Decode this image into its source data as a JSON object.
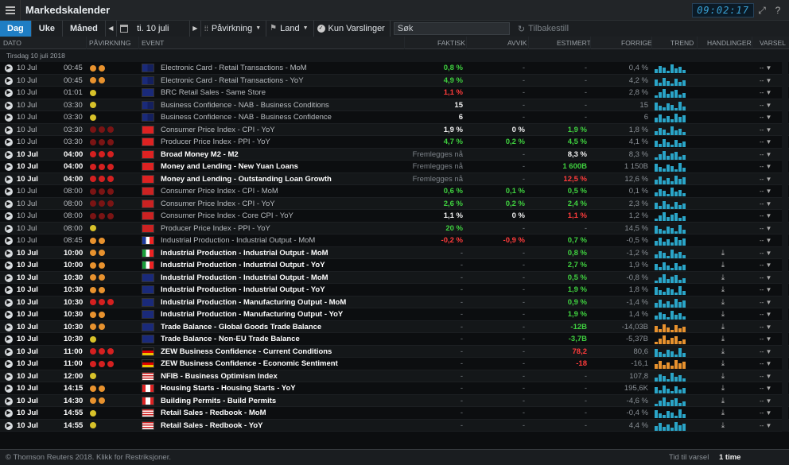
{
  "app": {
    "title": "Markedskalender",
    "clock": "09:02:17"
  },
  "toolbar": {
    "tabs": [
      "Dag",
      "Uke",
      "Måned"
    ],
    "date": "ti. 10 juli",
    "impact_label": "Påvirkning",
    "country_label": "Land",
    "alerts_only_label": "Kun Varslinger",
    "search_placeholder": "Søk",
    "reset_label": "Tilbakestill"
  },
  "columns": {
    "date": "DATO",
    "impact": "PÅVIRKNING",
    "event": "EVENT",
    "actual": "FAKTISK",
    "deviation": "AVVIK",
    "estimate": "ESTIMERT",
    "previous": "FORRIGE",
    "trend": "TREND",
    "actions": "HANDLINGER",
    "alert": "VARSEL"
  },
  "group_label": "Tirsdag 10 juli 2018",
  "colors": {
    "accent": "#1f7ec4",
    "orange": "#e8922e",
    "red": "#d42020",
    "yellow": "#d8c22a",
    "green": "#3fd13f",
    "trend": "#2aa5c8"
  },
  "rows": [
    {
      "date": "10 Jul",
      "time": "00:45",
      "impact": "medium",
      "country": "AU",
      "event": "Electronic Card - Retail Transactions - MoM",
      "actual": "0,8 %",
      "actual_c": "green",
      "dev": "-",
      "est": "-",
      "prev": "0,4 %",
      "action": false
    },
    {
      "date": "10 Jul",
      "time": "00:45",
      "impact": "medium",
      "country": "AU",
      "event": "Electronic Card - Retail Transactions - YoY",
      "actual": "4,9 %",
      "actual_c": "green",
      "dev": "-",
      "est": "-",
      "prev": "4,2 %",
      "action": false
    },
    {
      "date": "10 Jul",
      "time": "01:01",
      "impact": "low",
      "country": "UK",
      "event": "BRC Retail Sales - Same Store",
      "actual": "1,1 %",
      "actual_c": "red",
      "dev": "-",
      "est": "-",
      "prev": "2,8 %",
      "action": false
    },
    {
      "date": "10 Jul",
      "time": "03:30",
      "impact": "low",
      "country": "AU",
      "event": "Business Confidence - NAB - Business Conditions",
      "actual": "15",
      "actual_c": "white",
      "dev": "-",
      "est": "-",
      "prev": "15",
      "action": false
    },
    {
      "date": "10 Jul",
      "time": "03:30",
      "impact": "low",
      "country": "AU",
      "event": "Business Confidence - NAB - Business Confidence",
      "actual": "6",
      "actual_c": "white",
      "dev": "-",
      "est": "-",
      "prev": "6",
      "action": false
    },
    {
      "date": "10 Jul",
      "time": "03:30",
      "impact": "high-dim",
      "country": "CN",
      "event": "Consumer Price Index - CPI - YoY",
      "actual": "1,9 %",
      "actual_c": "white",
      "dev": "0 %",
      "dev_c": "white",
      "est": "1,9 %",
      "est_c": "green",
      "prev": "1,8 %",
      "action": false
    },
    {
      "date": "10 Jul",
      "time": "03:30",
      "impact": "high-dim",
      "country": "CN",
      "event": "Producer Price Index - PPI - YoY",
      "actual": "4,7 %",
      "actual_c": "green",
      "dev": "0,2 %",
      "dev_c": "green",
      "est": "4,5 %",
      "est_c": "green",
      "prev": "4,1 %",
      "action": false
    },
    {
      "date": "10 Jul",
      "time": "04:00",
      "impact": "high",
      "country": "CN",
      "event": "Broad Money M2 - M2",
      "actual": "Fremlegges nå",
      "actual_c": "pending",
      "dev": "-",
      "est": "8,3 %",
      "est_c": "white",
      "prev": "8,3 %",
      "action": false,
      "hi": true
    },
    {
      "date": "10 Jul",
      "time": "04:00",
      "impact": "high",
      "country": "CN",
      "event": "Money and Lending - New Yuan Loans",
      "actual": "Fremlegges nå",
      "actual_c": "pending",
      "dev": "-",
      "est": "1 600B",
      "est_c": "green",
      "prev": "1 150B",
      "action": false,
      "hi": true
    },
    {
      "date": "10 Jul",
      "time": "04:00",
      "impact": "high",
      "country": "CN",
      "event": "Money and Lending - Outstanding Loan Growth",
      "actual": "Fremlegges nå",
      "actual_c": "pending",
      "dev": "-",
      "est": "12,5 %",
      "est_c": "red",
      "prev": "12,6 %",
      "action": false,
      "hi": true
    },
    {
      "date": "10 Jul",
      "time": "08:00",
      "impact": "high-dim",
      "country": "NO",
      "event": "Consumer Price Index - CPI - MoM",
      "actual": "0,6 %",
      "actual_c": "green",
      "dev": "0,1 %",
      "dev_c": "green",
      "est": "0,5 %",
      "est_c": "green",
      "prev": "0,1 %",
      "action": false
    },
    {
      "date": "10 Jul",
      "time": "08:00",
      "impact": "high-dim",
      "country": "NO",
      "event": "Consumer Price Index - CPI - YoY",
      "actual": "2,6 %",
      "actual_c": "green",
      "dev": "0,2 %",
      "dev_c": "green",
      "est": "2,4 %",
      "est_c": "green",
      "prev": "2,3 %",
      "action": false
    },
    {
      "date": "10 Jul",
      "time": "08:00",
      "impact": "high-dim",
      "country": "NO",
      "event": "Consumer Price Index - Core CPI - YoY",
      "actual": "1,1 %",
      "actual_c": "white",
      "dev": "0 %",
      "dev_c": "white",
      "est": "1,1 %",
      "est_c": "red",
      "prev": "1,2 %",
      "action": false
    },
    {
      "date": "10 Jul",
      "time": "08:00",
      "impact": "low",
      "country": "NO",
      "event": "Producer Price Index - PPI - YoY",
      "actual": "20 %",
      "actual_c": "green",
      "dev": "-",
      "est": "-",
      "prev": "14,5 %",
      "action": false
    },
    {
      "date": "10 Jul",
      "time": "08:45",
      "impact": "medium",
      "country": "FR",
      "event": "Industrial Production - Industrial Output - MoM",
      "actual": "-0,2 %",
      "actual_c": "red",
      "dev": "-0,9 %",
      "dev_c": "red",
      "est": "0,7 %",
      "est_c": "green",
      "prev": "-0,5 %",
      "action": false
    },
    {
      "date": "10 Jul",
      "time": "10:00",
      "impact": "medium",
      "country": "IT",
      "event": "Industrial Production - Industrial Output - MoM",
      "actual": "-",
      "dev": "-",
      "est": "0,8 %",
      "est_c": "green",
      "prev": "-1,2 %",
      "action": true,
      "hi": true
    },
    {
      "date": "10 Jul",
      "time": "10:00",
      "impact": "medium",
      "country": "IT",
      "event": "Industrial Production - Industrial Output - YoY",
      "actual": "-",
      "dev": "-",
      "est": "2,7 %",
      "est_c": "green",
      "prev": "1,9 %",
      "action": true,
      "hi": true
    },
    {
      "date": "10 Jul",
      "time": "10:30",
      "impact": "medium",
      "country": "UK",
      "event": "Industrial Production - Industrial Output - MoM",
      "actual": "-",
      "dev": "-",
      "est": "0,5 %",
      "est_c": "green",
      "prev": "-0,8 %",
      "action": true,
      "hi": true
    },
    {
      "date": "10 Jul",
      "time": "10:30",
      "impact": "medium",
      "country": "UK",
      "event": "Industrial Production - Industrial Output - YoY",
      "actual": "-",
      "dev": "-",
      "est": "1,9 %",
      "est_c": "green",
      "prev": "1,8 %",
      "action": true,
      "hi": true
    },
    {
      "date": "10 Jul",
      "time": "10:30",
      "impact": "high",
      "country": "UK",
      "event": "Industrial Production - Manufacturing Output - MoM",
      "actual": "-",
      "dev": "-",
      "est": "0,9 %",
      "est_c": "green",
      "prev": "-1,4 %",
      "action": true,
      "hi": true
    },
    {
      "date": "10 Jul",
      "time": "10:30",
      "impact": "medium",
      "country": "UK",
      "event": "Industrial Production - Manufacturing Output - YoY",
      "actual": "-",
      "dev": "-",
      "est": "1,9 %",
      "est_c": "green",
      "prev": "1,4 %",
      "action": true,
      "hi": true
    },
    {
      "date": "10 Jul",
      "time": "10:30",
      "impact": "medium",
      "country": "UK",
      "event": "Trade Balance - Global Goods Trade Balance",
      "actual": "-",
      "dev": "-",
      "est": "-12B",
      "est_c": "green",
      "prev": "-14,03B",
      "action": true,
      "hi": true,
      "trend_c": "orange"
    },
    {
      "date": "10 Jul",
      "time": "10:30",
      "impact": "low",
      "country": "UK",
      "event": "Trade Balance - Non-EU Trade Balance",
      "actual": "-",
      "dev": "-",
      "est": "-3,7B",
      "est_c": "green",
      "prev": "-5,37B",
      "action": true,
      "hi": true,
      "trend_c": "orange"
    },
    {
      "date": "10 Jul",
      "time": "11:00",
      "impact": "high",
      "country": "DE",
      "event": "ZEW Business Confidence - Current Conditions",
      "actual": "-",
      "dev": "-",
      "est": "78,2",
      "est_c": "red",
      "prev": "80,6",
      "action": true,
      "hi": true
    },
    {
      "date": "10 Jul",
      "time": "11:00",
      "impact": "high",
      "country": "DE",
      "event": "ZEW Business Confidence - Economic Sentiment",
      "actual": "-",
      "dev": "-",
      "est": "-18",
      "est_c": "red",
      "prev": "-16,1",
      "action": true,
      "hi": true,
      "trend_c": "orange"
    },
    {
      "date": "10 Jul",
      "time": "12:00",
      "impact": "low",
      "country": "US",
      "event": "NFIB - Business Optimism Index",
      "actual": "-",
      "dev": "-",
      "est": "-",
      "prev": "107,8",
      "action": true,
      "hi": true
    },
    {
      "date": "10 Jul",
      "time": "14:15",
      "impact": "medium",
      "country": "CA",
      "event": "Housing Starts - Housing Starts - YoY",
      "actual": "-",
      "dev": "-",
      "est": "-",
      "prev": "195,6K",
      "action": true,
      "hi": true
    },
    {
      "date": "10 Jul",
      "time": "14:30",
      "impact": "medium",
      "country": "CA",
      "event": "Building Permits - Build Permits",
      "actual": "-",
      "dev": "-",
      "est": "-",
      "prev": "-4,6 %",
      "action": true,
      "hi": true
    },
    {
      "date": "10 Jul",
      "time": "14:55",
      "impact": "low",
      "country": "US",
      "event": "Retail Sales - Redbook - MoM",
      "actual": "-",
      "dev": "-",
      "est": "-",
      "prev": "-0,4 %",
      "action": true,
      "hi": true
    },
    {
      "date": "10 Jul",
      "time": "14:55",
      "impact": "low",
      "country": "US",
      "event": "Retail Sales - Redbook - YoY",
      "actual": "-",
      "dev": "-",
      "est": "-",
      "prev": "4,4 %",
      "action": true,
      "hi": true
    }
  ],
  "footer": {
    "copyright": "© Thomson Reuters 2018. Klikk for Restriksjoner.",
    "next_label": "Tid til varsel",
    "next_value": "1 time"
  }
}
